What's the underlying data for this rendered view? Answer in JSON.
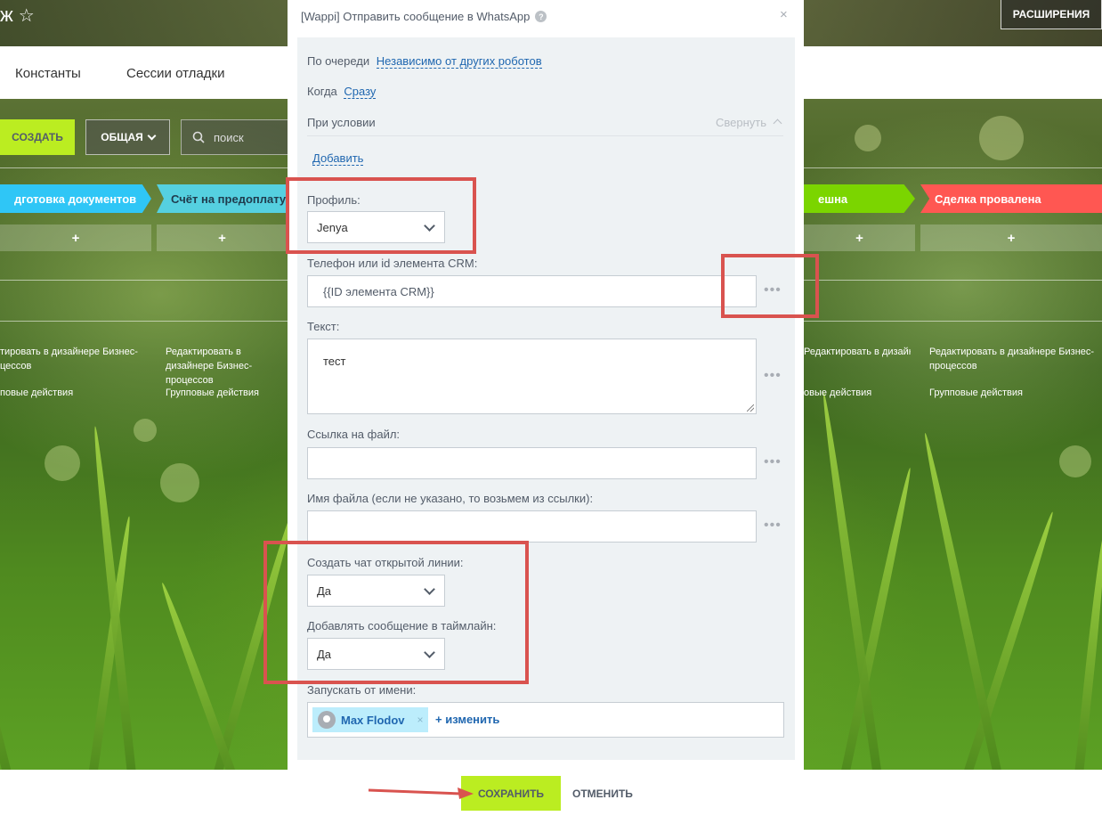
{
  "header": {
    "title": "ж",
    "extensions_label": "РАСШИРЕНИЯ"
  },
  "nav": {
    "items": [
      "Константы",
      "Сессии отладки"
    ]
  },
  "toolbar": {
    "create_label": "СОЗДАТЬ",
    "filter_label": "ОБЩАЯ",
    "search_placeholder": "поиск"
  },
  "stages": [
    {
      "name": "дготовка документов",
      "color": "#2fc6f6"
    },
    {
      "name": "Счёт на предоплату",
      "color": "#55d0e0"
    },
    {
      "name": "ешна",
      "color": "#7bd500"
    },
    {
      "name": "Сделка провалена",
      "color": "#ff5752"
    }
  ],
  "add_label": "+",
  "columns": {
    "edit_left": "тировать в дизайнере Бизнес-\nцессов",
    "edit_full": "Редактировать в дизайнере Бизнес-\nпроцессов",
    "edit_right_partial": "Редактировать в дизайнере Бизнес-",
    "edit_right_full": "Редактировать в дизайнере Бизнес-\nпроцессов",
    "group_left": "повые действия",
    "group_full": "Групповые действия",
    "group_right_partial": "овые действия",
    "group_right_full": "Групповые действия"
  },
  "modal": {
    "title": "[Wappi] Отправить сообщение в WhatsApp",
    "queue_label": "По очереди",
    "queue_value": "Независимо от других роботов",
    "when_label": "Когда",
    "when_value": "Сразу",
    "condition_label": "При условии",
    "collapse_label": "Свернуть",
    "add_label": "Добавить",
    "profile_label": "Профиль:",
    "profile_value": "Jenya",
    "phone_label": "Телефон или id элемента CRM:",
    "phone_value": "{{ID элемента CRM}}",
    "text_label": "Текст:",
    "text_value": "тест",
    "file_link_label": "Ссылка на файл:",
    "file_link_value": "",
    "file_name_label": "Имя файла (если не указано, то возьмем из ссылки):",
    "file_name_value": "",
    "open_line_label": "Создать чат открытой линии:",
    "open_line_value": "Да",
    "timeline_label": "Добавлять сообщение в таймлайн:",
    "timeline_value": "Да",
    "run_as_label": "Запускать от имени:",
    "run_as_user": "Max Flodov",
    "change_label": "+ изменить",
    "save_label": "СОХРАНИТЬ",
    "cancel_label": "ОТМЕНИТЬ",
    "dots": "•••",
    "close_glyph": "×",
    "help_glyph": "?"
  },
  "colors": {
    "accent_green": "#bbed21",
    "link_blue": "#2067b0",
    "annotation_red": "#d9534f"
  }
}
